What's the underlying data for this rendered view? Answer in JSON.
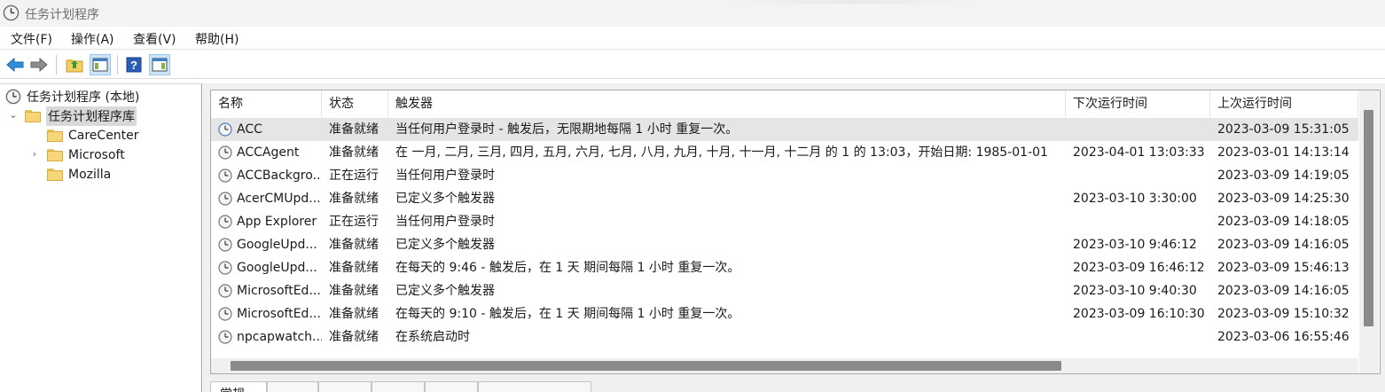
{
  "window": {
    "title": "任务计划程序"
  },
  "menu": [
    {
      "label": "文件(F)"
    },
    {
      "label": "操作(A)"
    },
    {
      "label": "查看(V)"
    },
    {
      "label": "帮助(H)"
    }
  ],
  "toolbar": {
    "buttons": [
      {
        "icon": "back-arrow-icon"
      },
      {
        "icon": "forward-arrow-icon"
      },
      {
        "icon": "up-folder-icon"
      },
      {
        "icon": "show-hide-console-tree-icon"
      },
      {
        "icon": "help-icon"
      },
      {
        "icon": "show-hide-action-pane-icon"
      }
    ]
  },
  "tree": {
    "root_label": "任务计划程序 (本地)",
    "library_label": "任务计划程序库",
    "expand_glyph": "⌄",
    "collapsed_glyph": "›",
    "children": [
      {
        "label": "CareCenter"
      },
      {
        "label": "Microsoft"
      },
      {
        "label": "Mozilla"
      }
    ]
  },
  "table": {
    "columns": [
      {
        "label": "名称"
      },
      {
        "label": "状态"
      },
      {
        "label": "触发器"
      },
      {
        "label": "下次运行时间"
      },
      {
        "label": "上次运行时间"
      }
    ],
    "rows": [
      {
        "name": "ACC",
        "status": "准备就绪",
        "trigger": "当任何用户登录时 - 触发后，无限期地每隔 1 小时 重复一次。",
        "next_run": "",
        "last_run": "2023-03-09 15:31:05"
      },
      {
        "name": "ACCAgent",
        "status": "准备就绪",
        "trigger": "在 一月, 二月, 三月, 四月, 五月, 六月, 七月, 八月, 九月, 十月, 十一月, 十二月 的 1 的 13:03，开始日期: 1985-01-01",
        "next_run": "2023-04-01 13:03:33",
        "last_run": "2023-03-01 14:13:14"
      },
      {
        "name": "ACCBackgro...",
        "status": "正在运行",
        "trigger": "当任何用户登录时",
        "next_run": "",
        "last_run": "2023-03-09 14:19:05"
      },
      {
        "name": "AcerCMUpd...",
        "status": "准备就绪",
        "trigger": "已定义多个触发器",
        "next_run": "2023-03-10 3:30:00",
        "last_run": "2023-03-09 14:25:30"
      },
      {
        "name": "App Explorer",
        "status": "正在运行",
        "trigger": "当任何用户登录时",
        "next_run": "",
        "last_run": "2023-03-09 14:18:05"
      },
      {
        "name": "GoogleUpd...",
        "status": "准备就绪",
        "trigger": "已定义多个触发器",
        "next_run": "2023-03-10 9:46:12",
        "last_run": "2023-03-09 14:16:05"
      },
      {
        "name": "GoogleUpd...",
        "status": "准备就绪",
        "trigger": "在每天的 9:46 - 触发后，在 1 天 期间每隔 1 小时 重复一次。",
        "next_run": "2023-03-09 16:46:12",
        "last_run": "2023-03-09 15:46:13"
      },
      {
        "name": "MicrosoftEd...",
        "status": "准备就绪",
        "trigger": "已定义多个触发器",
        "next_run": "2023-03-10 9:40:30",
        "last_run": "2023-03-09 14:16:05"
      },
      {
        "name": "MicrosoftEd...",
        "status": "准备就绪",
        "trigger": "在每天的 9:10 - 触发后，在 1 天 期间每隔 1 小时 重复一次。",
        "next_run": "2023-03-09 16:10:30",
        "last_run": "2023-03-09 15:10:32"
      },
      {
        "name": "npcapwatch...",
        "status": "准备就绪",
        "trigger": "在系统启动时",
        "next_run": "",
        "last_run": "2023-03-06 16:55:46"
      }
    ]
  },
  "bottom_tabs": [
    {
      "label": "常规"
    },
    {
      "label": ""
    },
    {
      "label": ""
    },
    {
      "label": ""
    },
    {
      "label": ""
    },
    {
      "label": ""
    }
  ],
  "colors": {
    "selection_row": "#e5e5e5",
    "toolbar_active": "#cce4f7",
    "scroll_thumb": "#8a8a8a"
  }
}
